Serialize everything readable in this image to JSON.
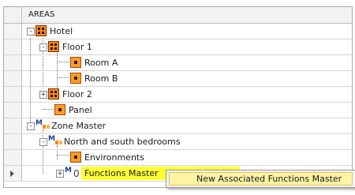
{
  "tree": {
    "header": "AREAS",
    "rows": [
      {
        "label": "Hotel",
        "icon": "area-grid-icon",
        "expander": "-"
      },
      {
        "label": "Floor 1",
        "icon": "area-grid-icon",
        "expander": "-"
      },
      {
        "label": "Room A",
        "icon": "room-icon"
      },
      {
        "label": "Room B",
        "icon": "room-icon"
      },
      {
        "label": "Floor 2",
        "icon": "area-grid-icon",
        "expander": "+"
      },
      {
        "label": "Panel",
        "icon": "room-icon"
      },
      {
        "label": "Zone Master",
        "icon": "zone-master-icon",
        "expander": "-"
      },
      {
        "label": "North and south bedrooms",
        "icon": "zone-master-icon",
        "expander": "-"
      },
      {
        "label": "Environments",
        "icon": "room-icon"
      },
      {
        "label": "Functions Master",
        "icon": "functions-master-icon",
        "expander": "+",
        "selected": true,
        "row_marker": ">"
      }
    ]
  },
  "context_menu": {
    "items": [
      {
        "label": "New  Associated Functions Master"
      }
    ]
  },
  "colors": {
    "selection_highlight": "#ffff33",
    "menu_hover": "#fff3a6",
    "icon_orange": "#ff8a1a",
    "zone_blue": "#1e3d8f"
  }
}
